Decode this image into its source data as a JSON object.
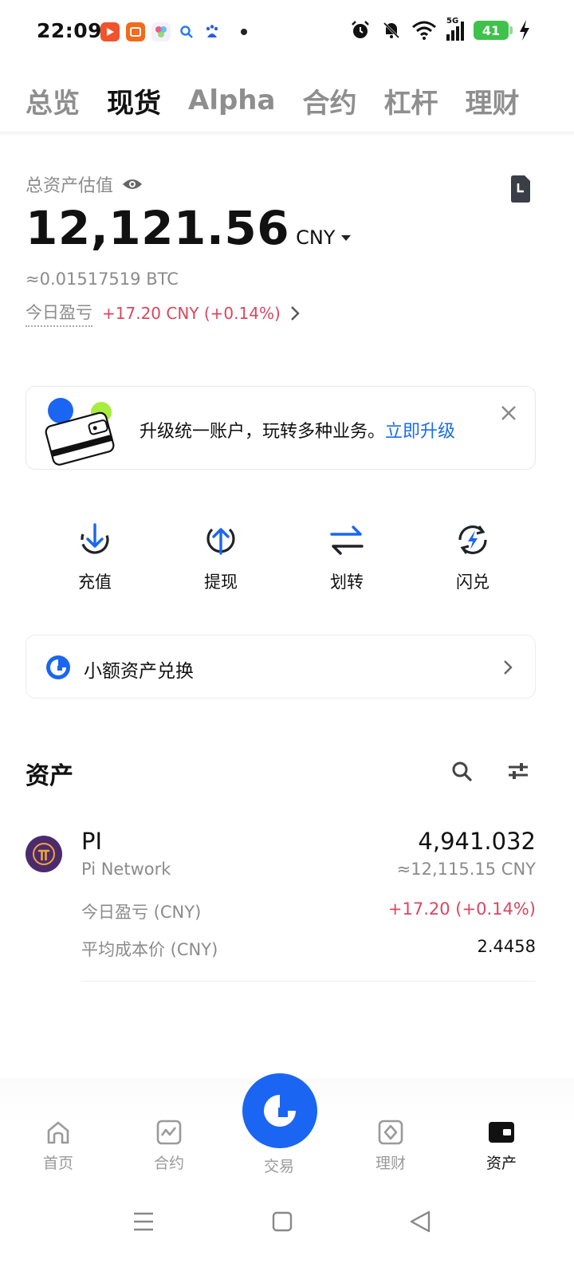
{
  "status_bar": {
    "time": "22:09",
    "battery": "41",
    "signal_label": "5G"
  },
  "top_tabs": [
    {
      "label": "总览",
      "active": false
    },
    {
      "label": "现货",
      "active": true
    },
    {
      "label": "Alpha",
      "active": false
    },
    {
      "label": "合约",
      "active": false
    },
    {
      "label": "杠杆",
      "active": false
    },
    {
      "label": "理财",
      "active": false
    }
  ],
  "balance": {
    "label": "总资产估值",
    "value": "12,121.56",
    "currency": "CNY",
    "btc_equiv": "≈0.01517519 BTC",
    "pnl_label": "今日盈亏",
    "pnl_value": "+17.20 CNY (+0.14%)"
  },
  "banner": {
    "text": "升级统一账户，玩转多种业务。",
    "link": "立即升级"
  },
  "actions": [
    {
      "label": "充值",
      "icon": "deposit-icon"
    },
    {
      "label": "提现",
      "icon": "withdraw-icon"
    },
    {
      "label": "划转",
      "icon": "transfer-icon"
    },
    {
      "label": "闪兑",
      "icon": "flash-convert-icon"
    }
  ],
  "dust": {
    "label": "小额资产兑换"
  },
  "assets": {
    "title": "资产",
    "items": [
      {
        "symbol": "PI",
        "name": "Pi Network",
        "amount": "4,941.032",
        "fiat": "≈12,115.15 CNY",
        "pnl_label": "今日盈亏 (CNY)",
        "pnl_value": "+17.20 (+0.14%)",
        "cost_label": "平均成本价 (CNY)",
        "cost_value": "2.4458"
      }
    ]
  },
  "bottom_nav": [
    {
      "label": "首页",
      "icon": "home-icon"
    },
    {
      "label": "合约",
      "icon": "futures-icon"
    },
    {
      "label": "交易",
      "icon": "trade-icon"
    },
    {
      "label": "理财",
      "icon": "earn-icon"
    },
    {
      "label": "资产",
      "icon": "wallet-icon",
      "active": true
    }
  ],
  "colors": {
    "accent": "#1a66f2",
    "positive": "#d9475f",
    "muted": "#8b8b8b",
    "link": "#1a6cf0"
  }
}
